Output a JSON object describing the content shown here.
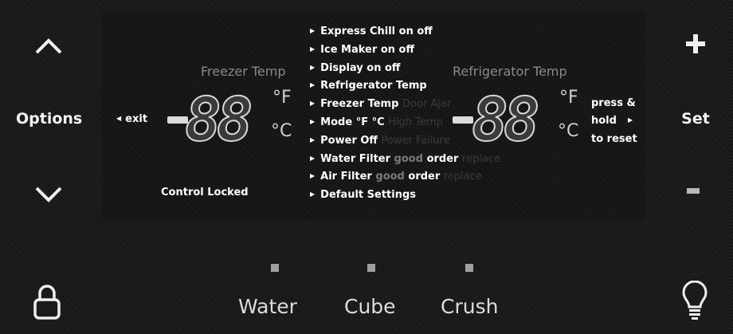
{
  "left_buttons": {
    "up_icon": "chevron-up",
    "options_label": "Options",
    "down_icon": "chevron-down"
  },
  "right_buttons": {
    "plus_label": "+",
    "set_label": "Set",
    "minus_label": "-"
  },
  "display": {
    "exit_label": "exit",
    "control_locked": "Control Locked",
    "freezer": {
      "title": "Freezer Temp",
      "minus": "-",
      "digits": "88",
      "unit_f": "°F",
      "unit_c": "°C"
    },
    "refrigerator": {
      "title": "Refrigerator Temp",
      "minus": "-",
      "digits": "88",
      "unit_f": "°F",
      "unit_c": "°C"
    },
    "reset_hint": {
      "line1": "press &",
      "line2": "hold",
      "line3": "to reset"
    },
    "menu": [
      {
        "label": "Express Chill",
        "extra": "on  off",
        "dim": ""
      },
      {
        "label": "Ice Maker",
        "extra": "on  off",
        "dim": ""
      },
      {
        "label": "Display",
        "extra": "on  off",
        "dim": ""
      },
      {
        "label": "Refrigerator Temp",
        "extra": "",
        "dim": ""
      },
      {
        "label": "Freezer Temp",
        "extra": "",
        "dim": "Door Ajar"
      },
      {
        "label": "Mode",
        "extra": "°F  °C",
        "dim": "High Temp"
      },
      {
        "label": "Power Off",
        "extra": "",
        "dim": "Power Failure"
      },
      {
        "label": "Water Filter",
        "good": "good",
        "extra": "order",
        "dim": "replace"
      },
      {
        "label": "Air Filter",
        "good": "good",
        "extra": "order",
        "dim": "replace"
      },
      {
        "label": "Default Settings",
        "extra": "",
        "dim": ""
      }
    ]
  },
  "dispenser": {
    "water_label": "Water",
    "cube_label": "Cube",
    "crush_label": "Crush"
  },
  "colors": {
    "panel": "#1a1a1a",
    "text": "#ffffff",
    "indicator": "#a0a0a0"
  }
}
